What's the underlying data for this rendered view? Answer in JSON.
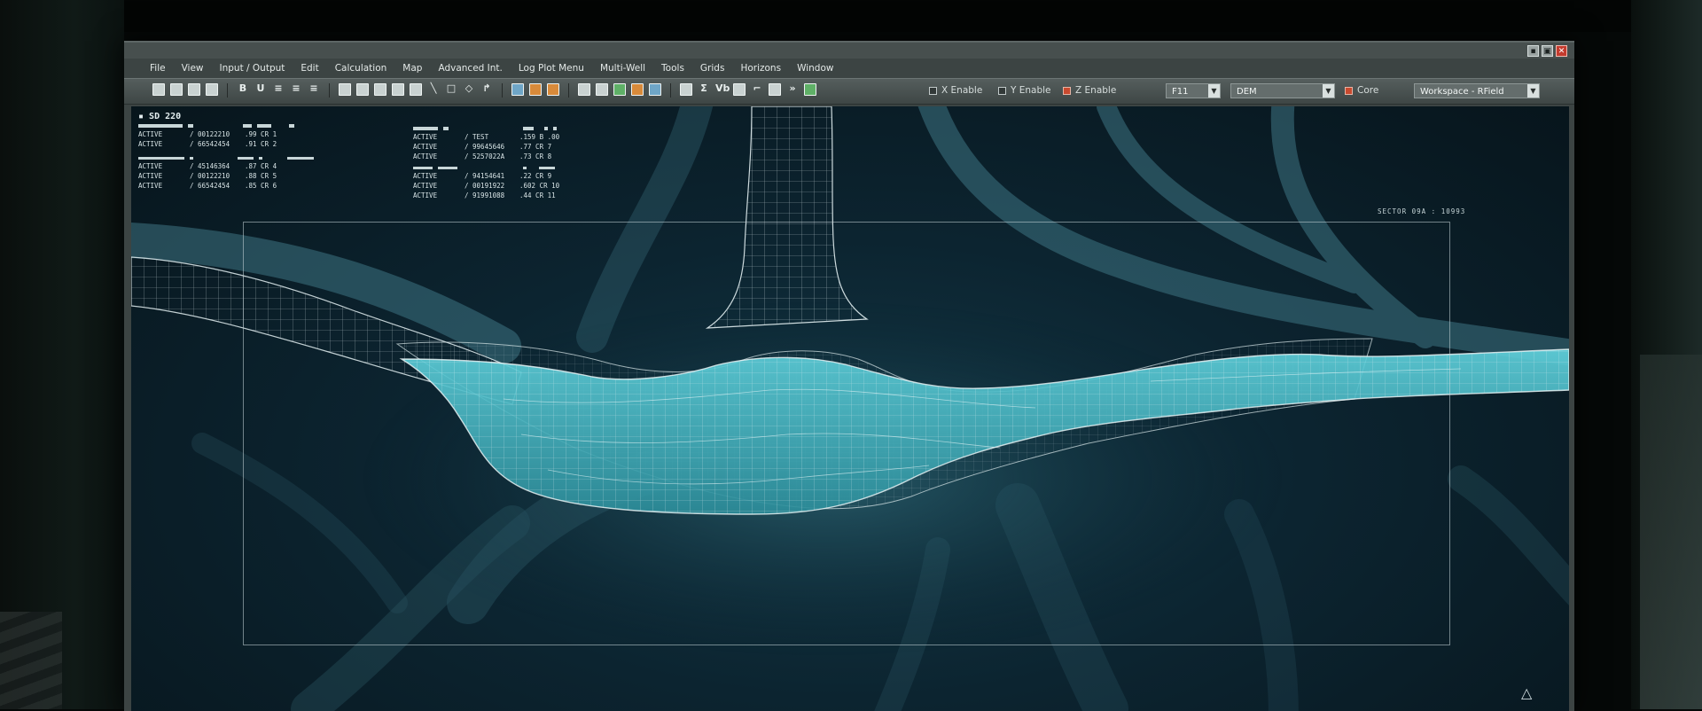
{
  "menu": [
    "File",
    "View",
    "Input / Output",
    "Edit",
    "Calculation",
    "Map",
    "Advanced Int.",
    "Log Plot Menu",
    "Multi-Well",
    "Tools",
    "Grids",
    "Horizons",
    "Window"
  ],
  "toolbar": {
    "x_enable": "X Enable",
    "y_enable": "Y Enable",
    "z_enable": "Z Enable",
    "select_key": "F11",
    "select_layer": "DEM",
    "core": "Core",
    "workspace": "Workspace - RField",
    "glyph_b": "B",
    "glyph_u": "U",
    "glyph_sigma": "Σ",
    "glyph_vb": "Vb"
  },
  "window_controls": {
    "min": "▪",
    "max": "▣",
    "close": "✕"
  },
  "readout_left": {
    "title": "SD 220",
    "block1": [
      {
        "status": "ACTIVE",
        "id": "/ 00122210",
        "val": ".99 CR 1"
      },
      {
        "status": "ACTIVE",
        "id": "/ 66542454",
        "val": ".91 CR 2"
      }
    ],
    "block2": [
      {
        "status": "ACTIVE",
        "id": "/ 45146364",
        "val": ".87 CR 4"
      },
      {
        "status": "ACTIVE",
        "id": "/ 00122210",
        "val": ".88 CR 5"
      },
      {
        "status": "ACTIVE",
        "id": "/ 66542454",
        "val": ".85 CR 6"
      }
    ]
  },
  "readout_right": {
    "block1": [
      {
        "status": "ACTIVE",
        "id": "/ TEST",
        "val": ".159 B .00"
      },
      {
        "status": "ACTIVE",
        "id": "/ 99645646",
        "val": ".77 CR 7"
      },
      {
        "status": "ACTIVE",
        "id": "/ 5257022A",
        "val": ".73 CR 8"
      }
    ],
    "block2": [
      {
        "status": "ACTIVE",
        "id": "/ 94154641",
        "val": ".22 CR 9"
      },
      {
        "status": "ACTIVE",
        "id": "/ 00191922",
        "val": ".602 CR 10"
      },
      {
        "status": "ACTIVE",
        "id": "/ 91991088",
        "val": ".44 CR 11"
      }
    ]
  },
  "sector_label": "SECTOR 09A : 10993",
  "nav_glyph": "△",
  "colors": {
    "fluid": "#4fc3cf",
    "mesh": "#d9e6e8",
    "background": "#0c2430"
  }
}
